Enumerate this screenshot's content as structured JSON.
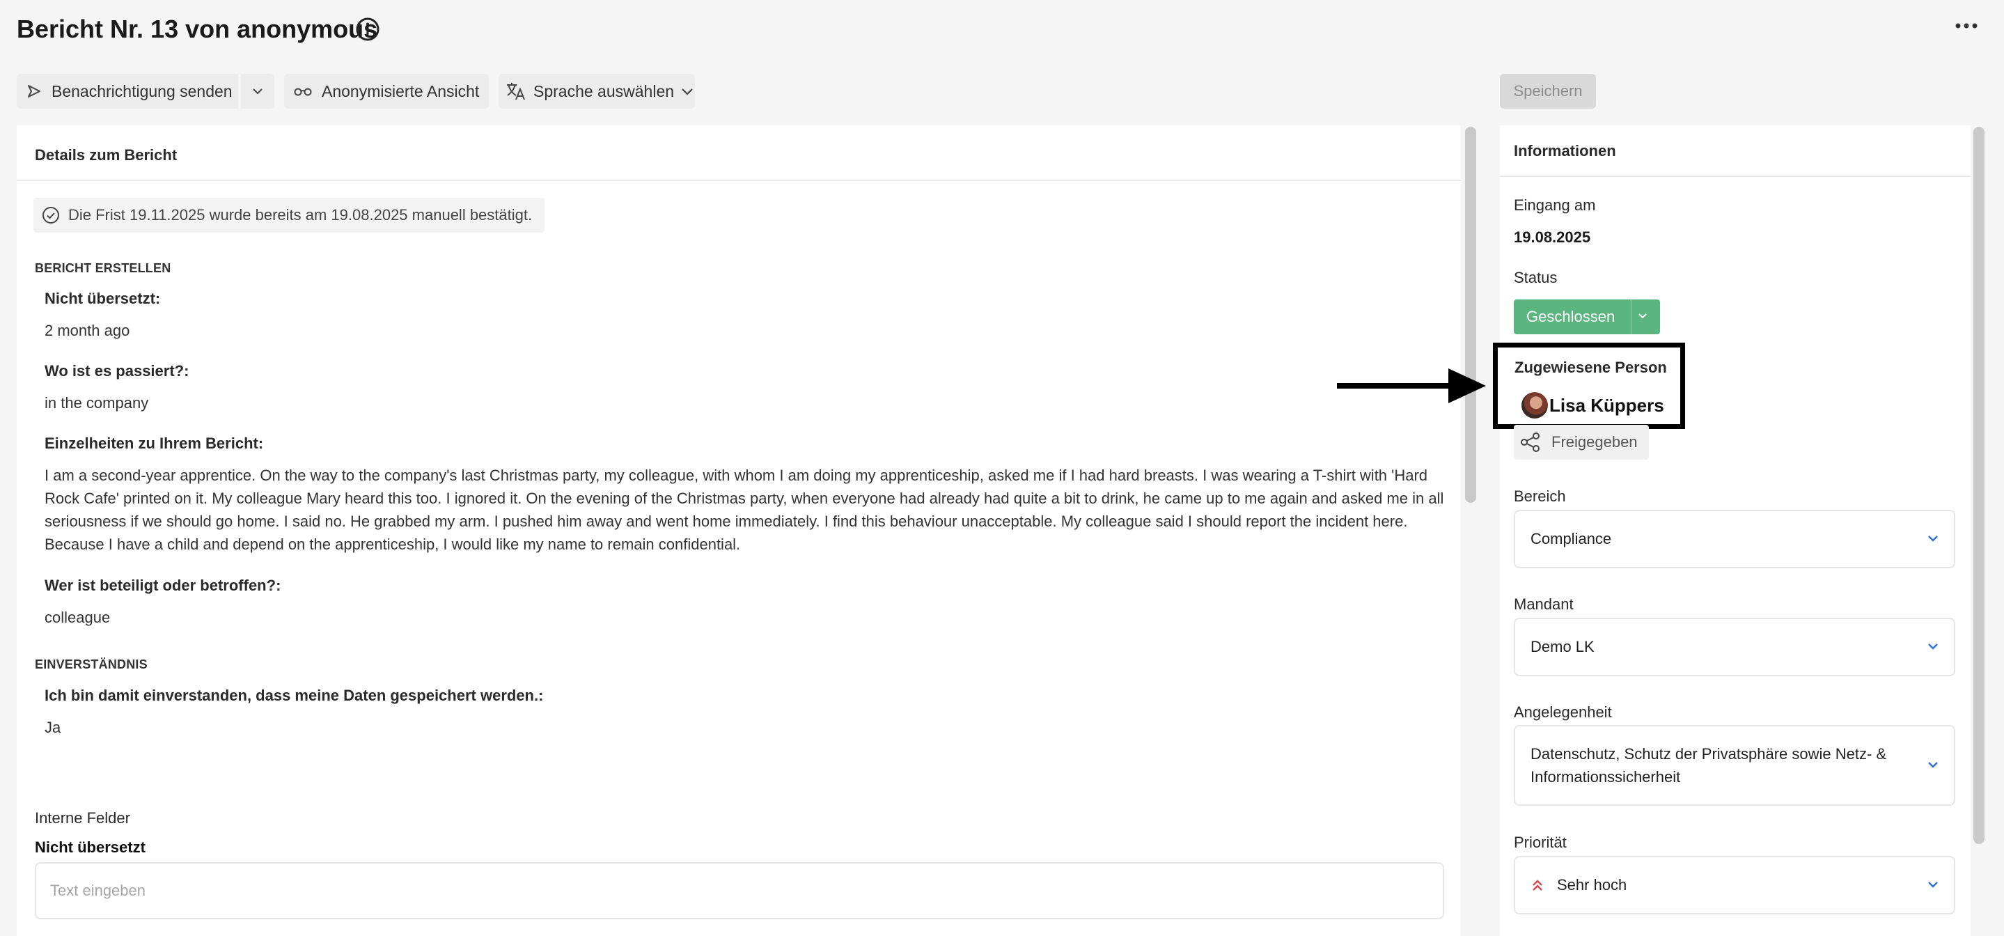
{
  "header": {
    "title": "Bericht Nr. 13 von anonymous",
    "save_label": "Speichern"
  },
  "toolbar": {
    "notify_label": "Benachrichtigung senden",
    "anon_label": "Anonymisierte Ansicht",
    "lang_label": "Sprache auswählen"
  },
  "details": {
    "heading": "Details zum Bericht",
    "deadline_note": "Die Frist 19.11.2025 wurde bereits am 19.08.2025 manuell bestätigt.",
    "section_create": "BERICHT ERSTELLEN",
    "fields": [
      {
        "label": "Nicht übersetzt:",
        "value": "2 month ago"
      },
      {
        "label": "Wo ist es passiert?:",
        "value": "in the company"
      },
      {
        "label": "Einzelheiten zu Ihrem Bericht:",
        "value": "I am a second-year apprentice. On the way to the company's last Christmas party, my colleague, with whom I am doing my apprenticeship, asked me if I had hard breasts. I was wearing a T-shirt with 'Hard Rock Cafe' printed on it. My colleague Mary heard this too. I ignored it. On the evening of the Christmas party, when everyone had already had quite a bit to drink, he came up to me again and asked me in all seriousness if we should go home. I said no. He grabbed my arm. I pushed him away and went home immediately. I find this behaviour unacceptable. My colleague said I should report the incident here. Because I have a child and depend on the apprenticeship, I would like my name to remain confidential."
      },
      {
        "label": "Wer ist beteiligt oder betroffen?:",
        "value": "colleague"
      }
    ],
    "section_consent": "EINVERSTÄNDNIS",
    "consent": {
      "label": "Ich bin damit einverstanden, dass meine Daten gespeichert werden.:",
      "value": "Ja"
    },
    "internal_heading": "Interne Felder",
    "internal_sub": "Nicht übersetzt",
    "internal_placeholder": "Text eingeben"
  },
  "info": {
    "heading": "Informationen",
    "received_label": "Eingang am",
    "received_value": "19.08.2025",
    "status_label": "Status",
    "status_value": "Geschlossen",
    "assignee_label": "Zugewiesene Person",
    "assignee_name": "Lisa Küppers",
    "shared_label": "Freigegeben",
    "area_label": "Bereich",
    "area_value": "Compliance",
    "client_label": "Mandant",
    "client_value": "Demo LK",
    "matter_label": "Angelegenheit",
    "matter_value": "Datenschutz, Schutz der Privatsphäre sowie Netz- & Informationssicherheit",
    "priority_label": "Priorität",
    "priority_value": "Sehr hoch"
  },
  "colors": {
    "status_green": "#5bb57e",
    "priority_red": "#e0454b",
    "chevron_blue": "#2f6fd6"
  }
}
